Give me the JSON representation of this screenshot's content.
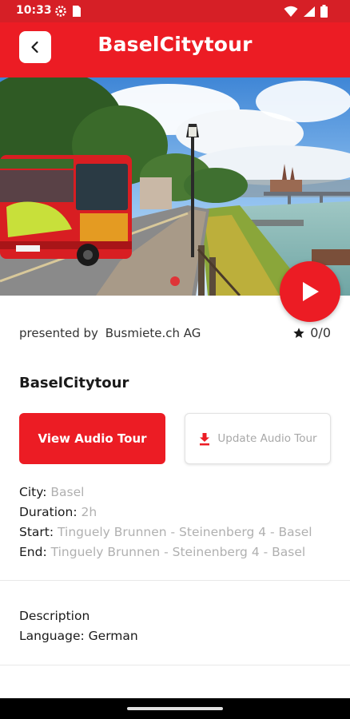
{
  "status_bar": {
    "time": "10:33",
    "left_icons": [
      "gear-icon",
      "sim-card-icon"
    ],
    "right_icons": [
      "wifi-icon",
      "signal-icon",
      "battery-icon"
    ]
  },
  "colors": {
    "accent": "#ec1c24",
    "status": "#d61f26",
    "muted": "#b0b0b0"
  },
  "header": {
    "title": "BaselCitytour",
    "back_icon": "chevron-left-icon"
  },
  "hero": {
    "image": "bus-on-riverside-promenade-basel",
    "play_icon": "play-icon"
  },
  "presenter": {
    "prefix": "presented by",
    "name": "Busmiete.ch AG"
  },
  "rating": {
    "icon": "star-icon",
    "value": "0/0"
  },
  "tour": {
    "name": "BaselCitytour"
  },
  "actions": {
    "view_label": "View Audio Tour",
    "update_label": "Update Audio Tour",
    "update_icon": "download-icon"
  },
  "details": {
    "city_label": "City:",
    "city_value": "Basel",
    "duration_label": "Duration:",
    "duration_value": "2h",
    "start_label": "Start:",
    "start_value": "Tinguely Brunnen - Steinenberg 4 - Basel",
    "end_label": "End:",
    "end_value": "Tinguely Brunnen - Steinenberg 4 - Basel"
  },
  "description": {
    "heading": "Description",
    "language": "Language: German"
  }
}
